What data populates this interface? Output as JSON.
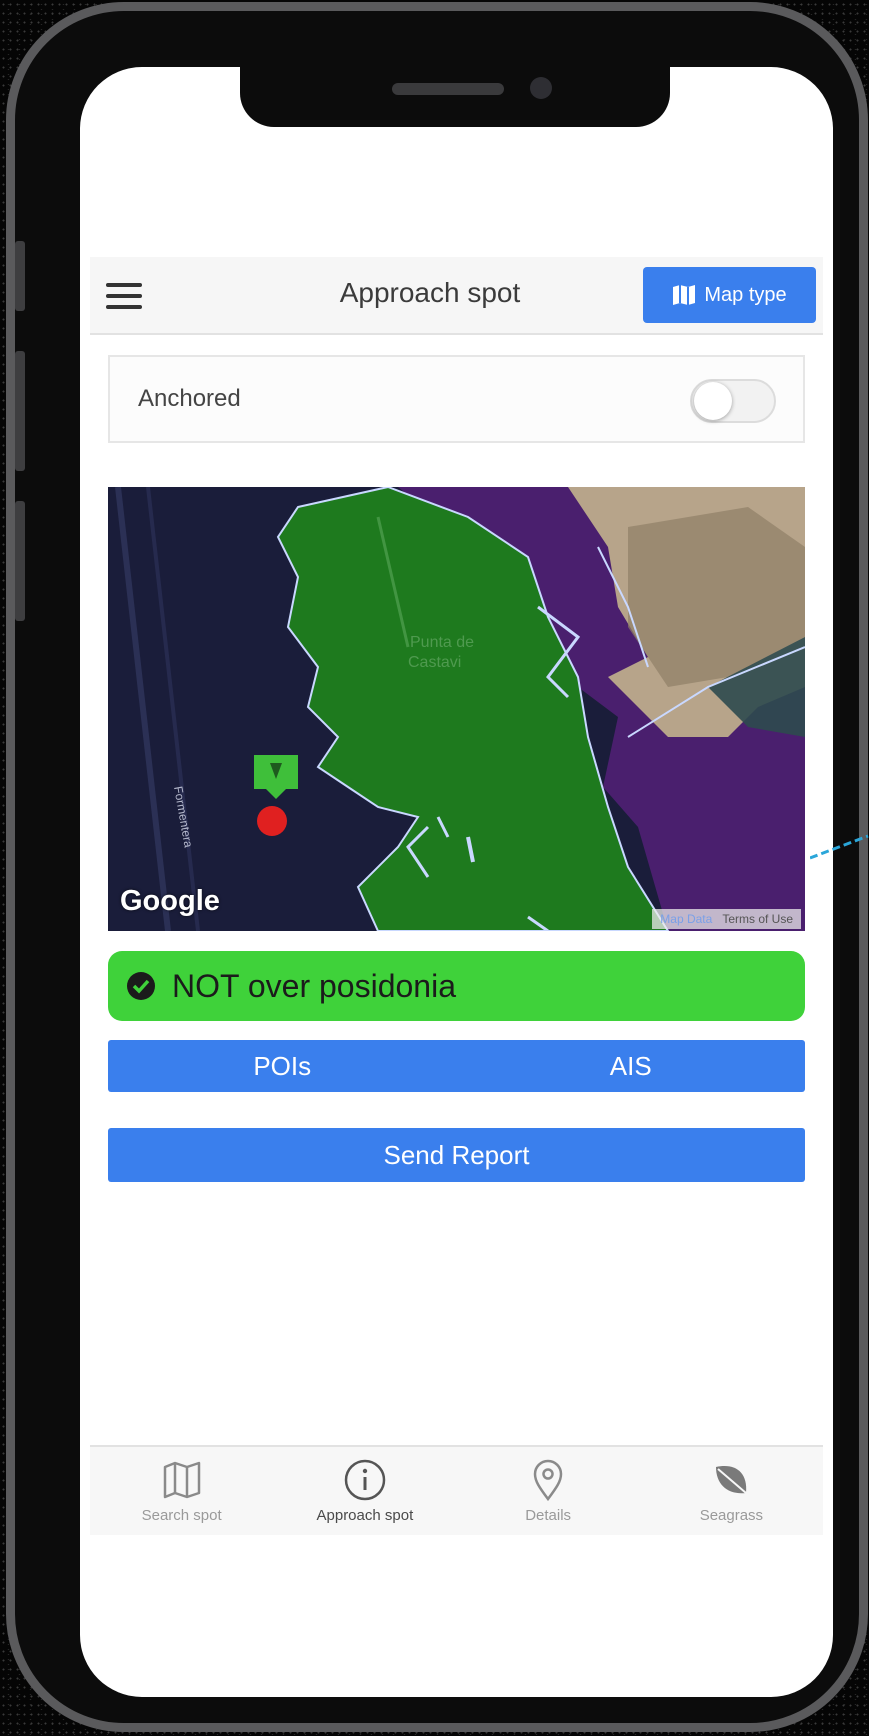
{
  "header": {
    "title": "Approach spot",
    "map_type_label": "Map type"
  },
  "anchored": {
    "label": "Anchored",
    "toggle_on": false
  },
  "map": {
    "provider_logo": "Google",
    "place_label_line1": "Punta de",
    "place_label_line2": "Castavi",
    "road_label": "Formentera",
    "attribution_data": "Map Data",
    "attribution_terms": "Terms of Use"
  },
  "status": {
    "text": "NOT over posidonia",
    "color": "#3fd23a"
  },
  "tabs": {
    "pois_label": "POIs",
    "ais_label": "AIS"
  },
  "send_report_label": "Send Report",
  "bottom_tabs": [
    {
      "label": "Search spot",
      "icon": "map-icon"
    },
    {
      "label": "Approach spot",
      "icon": "info-icon"
    },
    {
      "label": "Details",
      "icon": "location-pin-icon"
    },
    {
      "label": "Seagrass",
      "icon": "leaf-icon"
    }
  ],
  "colors": {
    "accent": "#3a7fed",
    "seagrass_zone": "#1e7a1e",
    "protected_zone": "#4a1f6e",
    "sea": "#1a1d3a"
  }
}
